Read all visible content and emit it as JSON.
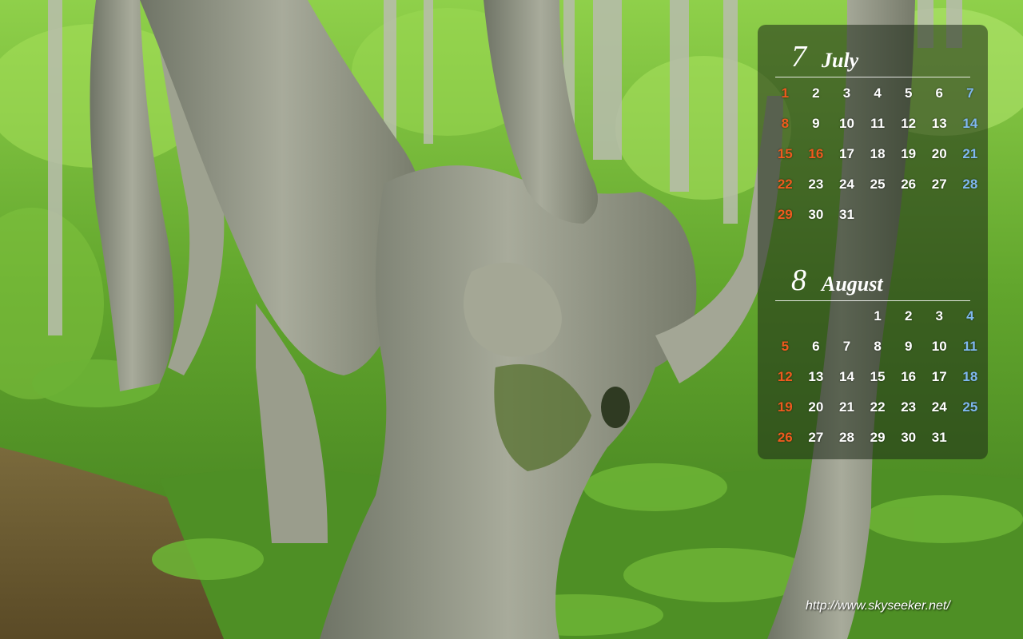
{
  "calendar": {
    "months": [
      {
        "number": "7",
        "name": "July",
        "first_weekday": 0,
        "days": [
          "1",
          "2",
          "3",
          "4",
          "5",
          "6",
          "7",
          "8",
          "9",
          "10",
          "11",
          "12",
          "13",
          "14",
          "15",
          "16",
          "17",
          "18",
          "19",
          "20",
          "21",
          "22",
          "23",
          "24",
          "25",
          "26",
          "27",
          "28",
          "29",
          "30",
          "31"
        ],
        "holidays": [
          "16"
        ]
      },
      {
        "number": "8",
        "name": "August",
        "first_weekday": 3,
        "days": [
          "1",
          "2",
          "3",
          "4",
          "5",
          "6",
          "7",
          "8",
          "9",
          "10",
          "11",
          "12",
          "13",
          "14",
          "15",
          "16",
          "17",
          "18",
          "19",
          "20",
          "21",
          "22",
          "23",
          "24",
          "25",
          "26",
          "27",
          "28",
          "29",
          "30",
          "31"
        ],
        "holidays": []
      }
    ],
    "colors": {
      "sunday_holiday": "#ef5a1e",
      "saturday": "#7fb8f0",
      "weekday": "#ffffff"
    }
  },
  "footer": {
    "url": "http://www.skyseeker.net/"
  },
  "photo": {
    "subject": "gnarled-beech-tree-forest",
    "colors": {
      "foliage": "#5f9e2e",
      "bark": "#8c8f7e",
      "ground": "#6b5a33"
    }
  }
}
